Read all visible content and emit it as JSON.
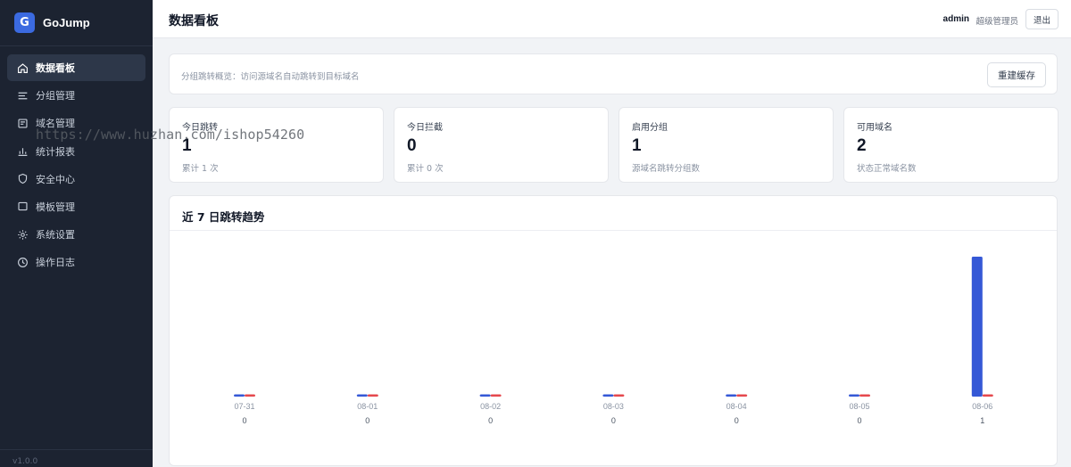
{
  "app": {
    "logo_letter": "G",
    "name": "GoJump",
    "version": "v1.0.0"
  },
  "sidebar": {
    "items": [
      {
        "label": "数据看板",
        "icon": "home-icon",
        "active": true
      },
      {
        "label": "分组管理",
        "icon": "list-icon",
        "active": false
      },
      {
        "label": "域名管理",
        "icon": "document-icon",
        "active": false
      },
      {
        "label": "统计报表",
        "icon": "bar-chart-icon",
        "active": false
      },
      {
        "label": "安全中心",
        "icon": "shield-icon",
        "active": false
      },
      {
        "label": "模板管理",
        "icon": "square-icon",
        "active": false
      },
      {
        "label": "系统设置",
        "icon": "gear-icon",
        "active": false
      },
      {
        "label": "操作日志",
        "icon": "clock-icon",
        "active": false
      }
    ]
  },
  "watermark": "https://www.huzhan.com/ishop54260",
  "header": {
    "title": "数据看板",
    "user": "admin",
    "role": "超级管理员",
    "logout_label": "退出"
  },
  "overview": {
    "text": "分组跳转概览：访问源域名自动跳转到目标域名",
    "rebuild_label": "重建缓存"
  },
  "stats": [
    {
      "label": "今日跳转",
      "value": "1",
      "sub": "累计 1 次"
    },
    {
      "label": "今日拦截",
      "value": "0",
      "sub": "累计 0 次"
    },
    {
      "label": "启用分组",
      "value": "1",
      "sub": "源域名跳转分组数"
    },
    {
      "label": "可用域名",
      "value": "2",
      "sub": "状态正常域名数"
    }
  ],
  "chart": {
    "title": "近 7 日跳转趋势"
  },
  "colors": {
    "accent": "#3558d6",
    "secondary": "#e5484d",
    "sidebar_bg": "#1c2331"
  },
  "chart_data": {
    "type": "bar",
    "categories": [
      "07-31",
      "08-01",
      "08-02",
      "08-03",
      "08-04",
      "08-05",
      "08-06"
    ],
    "series": [
      {
        "values": [
          0,
          0,
          0,
          0,
          0,
          0,
          1
        ]
      },
      {
        "values": [
          0,
          0,
          0,
          0,
          0,
          0,
          0
        ]
      }
    ],
    "count_labels": [
      "0",
      "0",
      "0",
      "0",
      "0",
      "0",
      "1"
    ],
    "title": "近 7 日跳转趋势",
    "xlabel": "",
    "ylabel": "",
    "ylim": [
      0,
      1
    ],
    "grid": false,
    "legend": "none"
  }
}
